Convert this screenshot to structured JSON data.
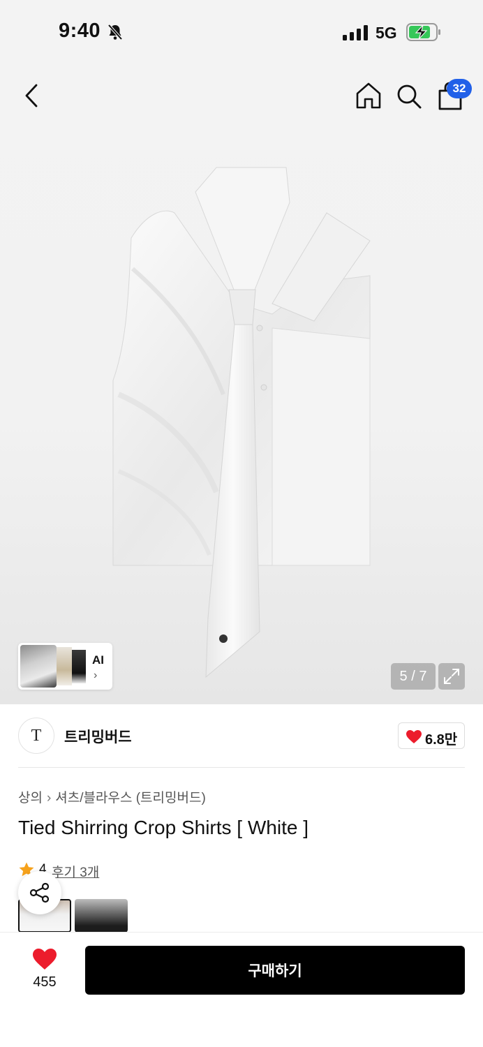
{
  "status_bar": {
    "time": "9:40",
    "network": "5G"
  },
  "header": {
    "cart_count": "32"
  },
  "gallery": {
    "ai_label": "AI",
    "ai_chevron": "›",
    "page_counter": "5 / 7"
  },
  "brand": {
    "logo_text": "T",
    "name": "트리밍버드",
    "likes": "6.8만"
  },
  "product": {
    "breadcrumb": {
      "category": "상의",
      "separator": "›",
      "subcategory": "셔츠/블라우스 (트리밍버드)"
    },
    "title": "Tied Shirring Crop Shirts [ White ]",
    "rating": "4",
    "review_link": "후기 3개"
  },
  "bottom_bar": {
    "wish_count": "455",
    "buy_label": "구매하기"
  },
  "colors": {
    "accent_badge": "#2160e8",
    "heart": "#ec1c2c",
    "star": "#f6a21b",
    "buy_button": "#000000"
  }
}
